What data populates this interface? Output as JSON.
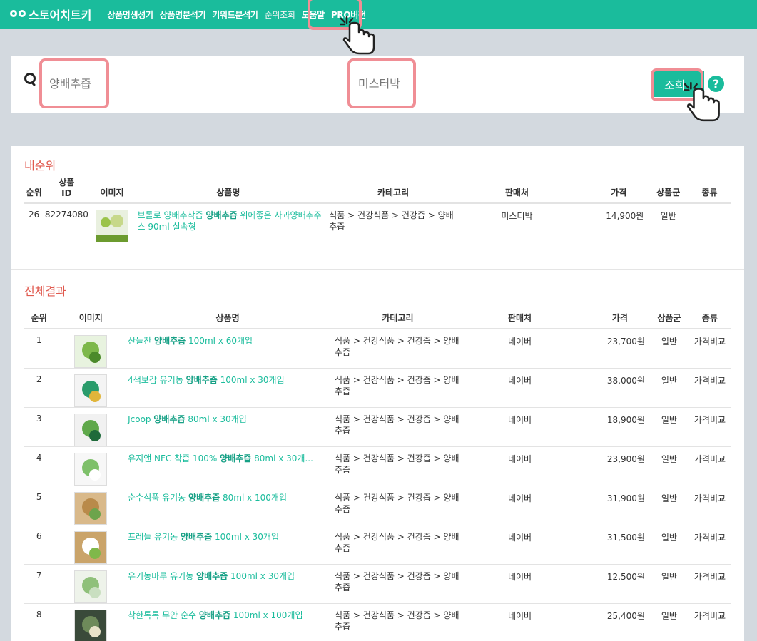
{
  "nav": {
    "logo_text": "스토어치트키",
    "items": [
      "상품명생성기",
      "상품명분석기",
      "키워드분석기",
      "순위조회",
      "도움말",
      "PRO버전"
    ]
  },
  "search": {
    "keyword_value": "양배추즙",
    "seller_value": "미스터박",
    "query_button": "조회",
    "help_symbol": "?"
  },
  "my_rank": {
    "title": "내순위",
    "headers": [
      "순위",
      "상품\nID",
      "이미지",
      "상품명",
      "카테고리",
      "판매처",
      "가격",
      "상품군",
      "종류"
    ],
    "header_id_line1": "상품",
    "header_id_line2": "ID",
    "row": {
      "rank": "26",
      "product_id": "82274080",
      "name_pre": "브롤로 양배추착즙 ",
      "name_kw": "양배추즙",
      "name_post": " 위에좋은 사과양배추주스 90ml 실속형",
      "category": "식품 > 건강식품 > 건강즙 > 양배추즙",
      "seller": "미스터박",
      "price": "14,900원",
      "group": "일반",
      "type": "-"
    }
  },
  "all_results": {
    "title": "전체결과",
    "headers": [
      "순위",
      "이미지",
      "상품명",
      "카테고리",
      "판매처",
      "가격",
      "상품군",
      "종류"
    ],
    "rows": [
      {
        "rank": "1",
        "pre": "산들찬 ",
        "kw": "양배추즙",
        "post": " 100ml x 60개입",
        "category": "식품 > 건강식품 > 건강즙 > 양배추즙",
        "seller": "네이버",
        "price": "23,700원",
        "group": "일반",
        "type": "가격비교"
      },
      {
        "rank": "2",
        "pre": "4색보감 유기농 ",
        "kw": "양배추즙",
        "post": " 100ml x 30개입",
        "category": "식품 > 건강식품 > 건강즙 > 양배추즙",
        "seller": "네이버",
        "price": "38,000원",
        "group": "일반",
        "type": "가격비교"
      },
      {
        "rank": "3",
        "pre": "Jcoop ",
        "kw": "양배추즙",
        "post": " 80ml x 30개입",
        "category": "식품 > 건강식품 > 건강즙 > 양배추즙",
        "seller": "네이버",
        "price": "18,900원",
        "group": "일반",
        "type": "가격비교"
      },
      {
        "rank": "4",
        "pre": "유지앤 NFC 착즙 100% ",
        "kw": "양배추즙",
        "post": " 80ml x 30개...",
        "category": "식품 > 건강식품 > 건강즙 > 양배추즙",
        "seller": "네이버",
        "price": "23,900원",
        "group": "일반",
        "type": "가격비교"
      },
      {
        "rank": "5",
        "pre": "순수식품 유기농 ",
        "kw": "양배추즙",
        "post": " 80ml x 100개입",
        "category": "식품 > 건강식품 > 건강즙 > 양배추즙",
        "seller": "네이버",
        "price": "31,900원",
        "group": "일반",
        "type": "가격비교"
      },
      {
        "rank": "6",
        "pre": "프레늘 유기농 ",
        "kw": "양배추즙",
        "post": " 100ml x 30개입",
        "category": "식품 > 건강식품 > 건강즙 > 양배추즙",
        "seller": "네이버",
        "price": "31,500원",
        "group": "일반",
        "type": "가격비교"
      },
      {
        "rank": "7",
        "pre": "유기농마루 유기농 ",
        "kw": "양배추즙",
        "post": " 100ml x 30개입",
        "category": "식품 > 건강식품 > 건강즙 > 양배추즙",
        "seller": "네이버",
        "price": "12,500원",
        "group": "일반",
        "type": "가격비교"
      },
      {
        "rank": "8",
        "pre": "착한톡톡 무안 순수 ",
        "kw": "양배추즙",
        "post": " 100ml x 100개입",
        "category": "식품 > 건강식품 > 건강즙 > 양배추즙",
        "seller": "네이버",
        "price": "25,400원",
        "group": "일반",
        "type": "가격비교"
      }
    ]
  },
  "colors": {
    "accent": "#1abc9c",
    "section_title": "#e05a4f",
    "highlight": "#f08e95",
    "background": "#d3d9df"
  }
}
